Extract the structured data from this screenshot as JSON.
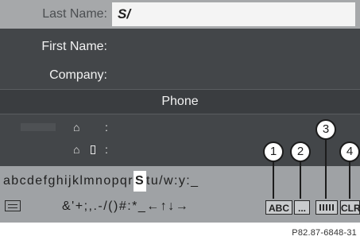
{
  "form": {
    "last_name_label": "Last Name:",
    "last_name_value": "S/",
    "first_name_label": "First Name:",
    "company_label": "Company:",
    "phone_header": "Phone",
    "phone_colon_1": ":",
    "phone_colon_2": ":"
  },
  "keyboard": {
    "row1_before": "abcdefghijklmnopqr",
    "row1_selected": "S",
    "row1_after": "tu/w:y:_",
    "row2_chars": "&'+;,.-/()#:*_←↑↓→",
    "key_abc": "ABC",
    "key_more": "...",
    "key_clr": "CLR"
  },
  "callouts": [
    "1",
    "2",
    "3",
    "4"
  ],
  "reference": "P82.87-6848-31",
  "colors": {
    "screen_bg": "#434649",
    "highlight_row": "#a6a8aa",
    "keyboard_bg": "#9fa2a5",
    "input_bg": "#f4f4f4"
  },
  "icons": [
    "home-phone-icon",
    "mobile-phone-icon",
    "keyboard-icon",
    "mode-icon"
  ]
}
